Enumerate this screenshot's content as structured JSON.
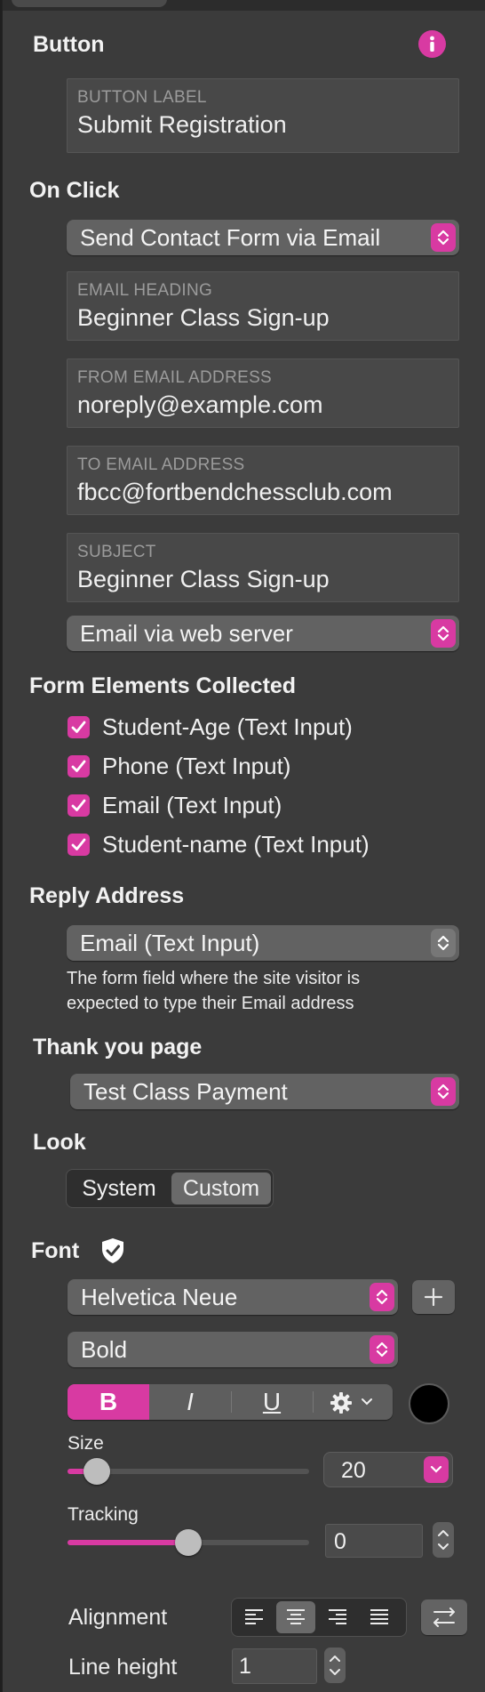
{
  "button_section": {
    "title": "Button",
    "label_field": {
      "label": "BUTTON LABEL",
      "value": "Submit Registration"
    }
  },
  "on_click": {
    "title": "On Click",
    "action": "Send Contact Form via Email",
    "email_heading": {
      "label": "EMAIL HEADING",
      "value": "Beginner Class Sign-up"
    },
    "from_email": {
      "label": "FROM EMAIL ADDRESS",
      "value": "noreply@example.com"
    },
    "to_email": {
      "label": "TO EMAIL ADDRESS",
      "value": "fbcc@fortbendchessclub.com"
    },
    "subject": {
      "label": "SUBJECT",
      "value": "Beginner Class Sign-up"
    },
    "delivery": "Email via web server"
  },
  "form_elements": {
    "title": "Form Elements Collected",
    "items": [
      {
        "label": "Student-Age (Text Input)",
        "checked": true
      },
      {
        "label": "Phone (Text Input)",
        "checked": true
      },
      {
        "label": "Email (Text Input)",
        "checked": true
      },
      {
        "label": "Student-name (Text Input)",
        "checked": true
      }
    ]
  },
  "reply_address": {
    "title": "Reply Address",
    "value": "Email (Text Input)",
    "desc_line1": "The form field where the site visitor is",
    "desc_line2": "expected to type their Email address"
  },
  "thank_you": {
    "title": "Thank you page",
    "value": "Test Class Payment"
  },
  "look": {
    "title": "Look",
    "options": [
      "System",
      "Custom"
    ],
    "selected": "Custom"
  },
  "font": {
    "title": "Font",
    "family": "Helvetica Neue",
    "style": "Bold",
    "bold_label": "B",
    "italic_label": "I",
    "underline_label": "U",
    "color": "#000000",
    "size_label": "Size",
    "size_value": "20",
    "size_slider_fraction": 0.12,
    "tracking_label": "Tracking",
    "tracking_value": "0",
    "tracking_slider_fraction": 0.5,
    "alignment_label": "Alignment",
    "alignment_selected": "center",
    "line_height_label": "Line height",
    "line_height_value": "1"
  },
  "colors": {
    "accent": "#d83aa2",
    "panel": "#3b3b3b",
    "field": "#484848"
  },
  "icons": {
    "info": "info-icon",
    "shield": "shield-check-icon",
    "gear": "gear-icon",
    "plus": "plus-icon"
  }
}
